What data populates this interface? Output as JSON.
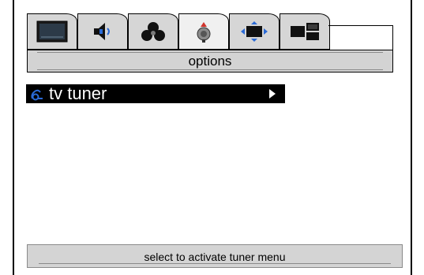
{
  "tabs": [
    {
      "name": "picture",
      "icon": "tv-screen-icon"
    },
    {
      "name": "audio",
      "icon": "speaker-icon"
    },
    {
      "name": "color",
      "icon": "color-circles-icon"
    },
    {
      "name": "options",
      "icon": "options-icon",
      "active": true
    },
    {
      "name": "size",
      "icon": "screen-size-icon"
    },
    {
      "name": "pip",
      "icon": "pip-icon"
    }
  ],
  "header": {
    "title": "options"
  },
  "menu": {
    "items": [
      {
        "label": "tv tuner",
        "icon": "tuner-icon",
        "has_submenu": true,
        "selected": true
      }
    ]
  },
  "status": {
    "text": "select to activate tuner menu"
  },
  "colors": {
    "highlight": "#000000",
    "band": "#d3d3d3",
    "accent_red": "#d0342c",
    "accent_blue": "#2a6ad6"
  }
}
